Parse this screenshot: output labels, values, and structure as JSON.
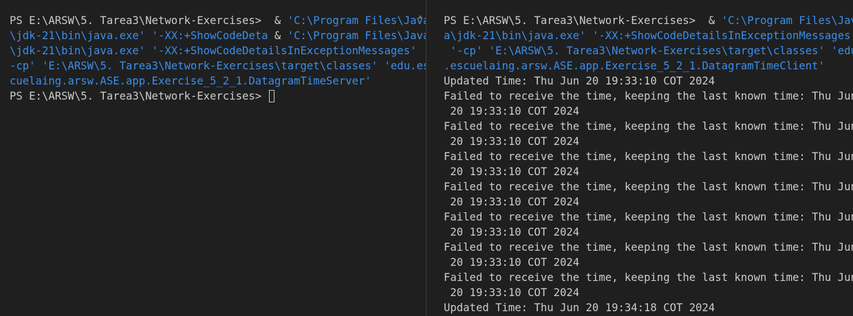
{
  "colors": {
    "background": "#1f1f1f",
    "text": "#cccccc",
    "argument": "#3b8eea",
    "divider": "#3c3c3c"
  },
  "left_pane": {
    "lines": [
      [
        {
          "t": "PS E:\\ARSW\\5. Tarea3\\Network-Exercises>  & ",
          "c": "plain"
        },
        {
          "t": "'C:\\Program Files\\Java",
          "c": "arg"
        }
      ],
      [
        {
          "t": "\\jdk-21\\bin\\java.exe'",
          "c": "arg"
        },
        {
          "t": " ",
          "c": "plain"
        },
        {
          "t": "'-XX:+ShowCodeDeta",
          "c": "arg"
        },
        {
          "t": " & ",
          "c": "plain"
        },
        {
          "t": "'C:\\Program Files\\Java",
          "c": "arg"
        }
      ],
      [
        {
          "t": "\\jdk-21\\bin\\java.exe'",
          "c": "arg"
        },
        {
          "t": " ",
          "c": "plain"
        },
        {
          "t": "'-XX:+ShowCodeDetailsInExceptionMessages'",
          "c": "arg"
        },
        {
          "t": " '",
          "c": "arg"
        }
      ],
      [
        {
          "t": "-cp'",
          "c": "arg"
        },
        {
          "t": " 'E:\\ARSW\\5. Tarea3\\Network-Exercises\\target\\classes' 'edu.es",
          "c": "arg"
        }
      ],
      [
        {
          "t": "cuelaing.arsw.ASE.app.Exercise_5_2_1.DatagramTimeServer'",
          "c": "arg"
        }
      ],
      [
        {
          "t": "PS E:\\ARSW\\5. Tarea3\\Network-Exercises> ",
          "c": "plain"
        }
      ]
    ]
  },
  "right_pane": {
    "lines": [
      [
        {
          "t": "PS E:\\ARSW\\5. Tarea3\\Network-Exercises>  & ",
          "c": "plain"
        },
        {
          "t": "'C:\\Program Files\\Jav",
          "c": "arg"
        }
      ],
      [
        {
          "t": "a\\jdk-21\\bin\\java.exe'",
          "c": "arg"
        },
        {
          "t": " ",
          "c": "plain"
        },
        {
          "t": "'-XX:+ShowCodeDetailsInExceptionMessages'",
          "c": "arg"
        }
      ],
      [
        {
          "t": " '-cp'",
          "c": "arg"
        },
        {
          "t": " ",
          "c": "plain"
        },
        {
          "t": "'E:\\ARSW\\5. Tarea3\\Network-Exercises\\target\\classes'",
          "c": "arg"
        },
        {
          "t": " ",
          "c": "plain"
        },
        {
          "t": "'edu",
          "c": "arg"
        }
      ],
      [
        {
          "t": ".escuelaing.arsw.ASE.app.Exercise_5_2_1.DatagramTimeClient'",
          "c": "arg"
        }
      ],
      [
        {
          "t": "Updated Time: Thu Jun 20 19:33:10 COT 2024",
          "c": "plain"
        }
      ],
      [
        {
          "t": "Failed to receive the time, keeping the last known time: Thu Jun",
          "c": "plain"
        }
      ],
      [
        {
          "t": " 20 19:33:10 COT 2024",
          "c": "plain"
        }
      ],
      [
        {
          "t": "Failed to receive the time, keeping the last known time: Thu Jun",
          "c": "plain"
        }
      ],
      [
        {
          "t": " 20 19:33:10 COT 2024",
          "c": "plain"
        }
      ],
      [
        {
          "t": "Failed to receive the time, keeping the last known time: Thu Jun",
          "c": "plain"
        }
      ],
      [
        {
          "t": " 20 19:33:10 COT 2024",
          "c": "plain"
        }
      ],
      [
        {
          "t": "Failed to receive the time, keeping the last known time: Thu Jun",
          "c": "plain"
        }
      ],
      [
        {
          "t": " 20 19:33:10 COT 2024",
          "c": "plain"
        }
      ],
      [
        {
          "t": "Failed to receive the time, keeping the last known time: Thu Jun",
          "c": "plain"
        }
      ],
      [
        {
          "t": " 20 19:33:10 COT 2024",
          "c": "plain"
        }
      ],
      [
        {
          "t": "Failed to receive the time, keeping the last known time: Thu Jun",
          "c": "plain"
        }
      ],
      [
        {
          "t": " 20 19:33:10 COT 2024",
          "c": "plain"
        }
      ],
      [
        {
          "t": "Failed to receive the time, keeping the last known time: Thu Jun",
          "c": "plain"
        }
      ],
      [
        {
          "t": " 20 19:33:10 COT 2024",
          "c": "plain"
        }
      ],
      [
        {
          "t": "Updated Time: Thu Jun 20 19:34:18 COT 2024",
          "c": "plain"
        }
      ]
    ]
  }
}
